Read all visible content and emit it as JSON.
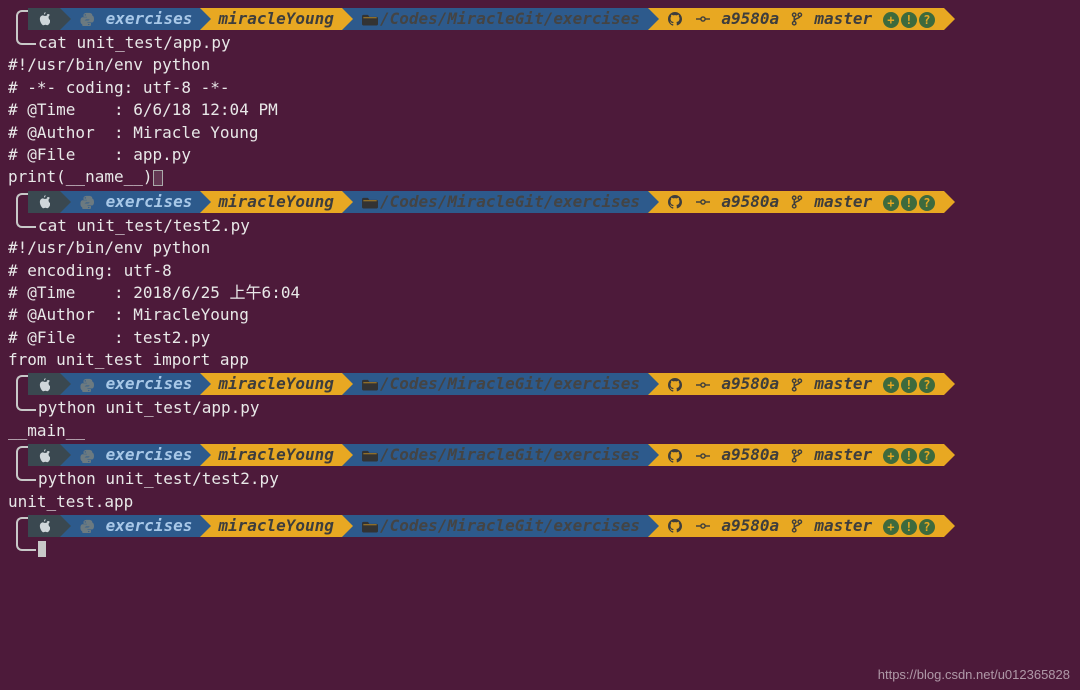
{
  "prompt": {
    "env": "exercises",
    "user": "miracleYoung",
    "path": "/Codes/MiracleGit/exercises",
    "commit": "a9580a",
    "branch": "master",
    "badges": [
      "+",
      "!",
      "?"
    ]
  },
  "blocks": [
    {
      "cmd": "cat unit_test/app.py",
      "out": [
        "#!/usr/bin/env python",
        "# -*- coding: utf-8 -*-",
        "# @Time    : 6/6/18 12:04 PM",
        "# @Author  : Miracle Young",
        "# @File    : app.py",
        "",
        "",
        "print(__name__)"
      ],
      "trailing_cursor": "box"
    },
    {
      "cmd": "cat unit_test/test2.py",
      "out": [
        "#!/usr/bin/env python",
        "# encoding: utf-8",
        "# @Time    : 2018/6/25 上午6:04",
        "# @Author  : MiracleYoung",
        "# @File    : test2.py",
        "",
        "from unit_test import app"
      ]
    },
    {
      "cmd": "python unit_test/app.py",
      "out": [
        "__main__"
      ]
    },
    {
      "cmd": "python unit_test/test2.py",
      "out": [
        "unit_test.app"
      ]
    },
    {
      "cmd": "",
      "out": [],
      "trailing_cursor": "solid"
    }
  ],
  "watermark": "https://blog.csdn.net/u012365828"
}
